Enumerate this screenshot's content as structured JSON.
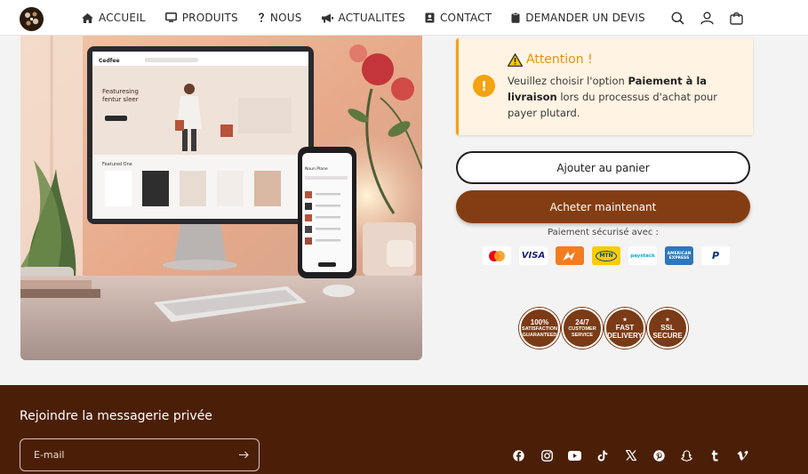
{
  "header": {
    "logo_icon": "brand-logo-icon",
    "nav": [
      {
        "label": "ACCUEIL",
        "icon": "home-icon"
      },
      {
        "label": "PRODUITS",
        "icon": "monitor-icon"
      },
      {
        "label": "NOUS",
        "icon": "question-icon"
      },
      {
        "label": "ACTUALITES",
        "icon": "megaphone-icon"
      },
      {
        "label": "CONTACT",
        "icon": "contact-book-icon"
      },
      {
        "label": "DEMANDER UN DEVIS",
        "icon": "clipboard-icon"
      }
    ],
    "icons": [
      "search-icon",
      "account-icon",
      "cart-icon"
    ]
  },
  "product_image": {
    "monitor_brand": "Cedfee",
    "monitor_heading_line1": "Featuresing",
    "monitor_heading_line2": "fentur sleer",
    "monitor_section": "Featured One",
    "phone_heading": "Noun Plane"
  },
  "notice": {
    "title": "Attention !",
    "text_before": "Veuillez choisir l'option ",
    "text_bold": "Paiement à la livraison",
    "text_after": " lors du processus d'achat pour payer plutard."
  },
  "actions": {
    "add_to_cart": "Ajouter au panier",
    "buy_now": "Acheter maintenant"
  },
  "payment": {
    "label": "Paiement sécurisé avec :",
    "methods": [
      {
        "name": "mastercard",
        "text": "",
        "bg": "#ffffff",
        "color": "#222"
      },
      {
        "name": "visa",
        "text": "VISA",
        "bg": "#ffffff",
        "color": "#1a1f71"
      },
      {
        "name": "airtel",
        "text": "",
        "bg": "#f47b20",
        "color": "#fff"
      },
      {
        "name": "mtn",
        "text": "MTN",
        "bg": "#ffcb05",
        "color": "#004f71"
      },
      {
        "name": "paystack",
        "text": "paystack",
        "bg": "#ffffff",
        "color": "#0ba4db"
      },
      {
        "name": "amex",
        "text": "AMERICAN EXPRESS",
        "bg": "#2e77bc",
        "color": "#fff"
      },
      {
        "name": "paypal",
        "text": "P",
        "bg": "#ffffff",
        "color": "#003087"
      }
    ]
  },
  "badges": [
    {
      "main": "100%",
      "sub": "SATISFACTION GUARANTEED"
    },
    {
      "main": "24/7",
      "sub": "CUSTOMER SERVICE"
    },
    {
      "main": "FAST DELIVERY",
      "sub": "★"
    },
    {
      "main": "SSL SECURE",
      "sub": "★"
    }
  ],
  "footer": {
    "newsletter_title": "Rejoindre la messagerie privée",
    "email_placeholder": "E-mail",
    "socials": [
      "facebook-icon",
      "instagram-icon",
      "youtube-icon",
      "tiktok-icon",
      "x-icon",
      "pinterest-icon",
      "snapchat-icon",
      "tumblr-icon",
      "vimeo-icon"
    ]
  },
  "colors": {
    "accent_brown": "#843d12",
    "footer_bg": "#4b1f07",
    "warning_orange": "#f2a11a"
  }
}
